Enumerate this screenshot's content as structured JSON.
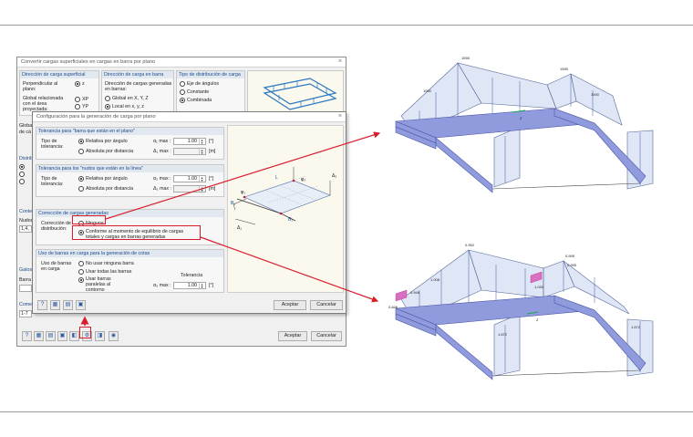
{
  "back_dialog": {
    "title": "Convertir cargas superficiales en cargas en barra por plano",
    "close_glyph": "×",
    "groups": {
      "load_direction_surface": {
        "header": "Dirección de carga superficial",
        "perpendicular_label": "Perpendicular al plano:",
        "perpendicular_option": "z",
        "global_label": "Global relacionada con el área proyectada:",
        "xp_option": "XP",
        "yp_option": "YP"
      },
      "load_direction_member": {
        "header": "Dirección de carga en barra",
        "description": "Dirección de cargas generadas en barras:",
        "global_option": "Global en X, Y, Z",
        "local_option": "Local en x, y, z"
      },
      "distribution_type": {
        "header": "Tipo de distribución de carga",
        "options": [
          "Eje de ángulos",
          "Constante",
          "Combinada"
        ]
      }
    },
    "side_labels": [
      "Global",
      "de cá",
      "Distrib",
      "Conte",
      "Nudos",
      "1,4,",
      "Gatos",
      "Barra",
      "Comer",
      "1-7"
    ],
    "accept_label": "Aceptar",
    "cancel_label": "Cancelar"
  },
  "front_dialog": {
    "title": "Configuración para la generación de carga por plano",
    "close_glyph": "×",
    "tolerance_plane": {
      "header": "Tolerancia para \"barra que están en el plano\"",
      "type_label": "Tipo de tolerancia:",
      "relative_option": "Relativa por ángulo",
      "absolute_option": "Absoluta por distancia",
      "angle_label": "α₁ max :",
      "angle_value": "1.00",
      "angle_unit": "[°]",
      "dist_label": "Δ₁ max :",
      "dist_value": "",
      "dist_unit": "[m]"
    },
    "tolerance_nodes": {
      "header": "Tolerancia para los \"nudos que están en la línea\"",
      "type_label": "Tipo de tolerancia:",
      "relative_option": "Relativa por ángulo",
      "absolute_option": "Absoluta por distancia",
      "angle_label": "α₂ max :",
      "angle_value": "1.00",
      "angle_unit": "[°]",
      "dist_label": "Δ₂ max :",
      "dist_value": "",
      "dist_unit": "[m]"
    },
    "load_correction": {
      "header": "Corrección de cargas generadas",
      "distribution_label": "Corrección de distribución:",
      "none_option": "Ninguna",
      "equilibrium_option": "Conforme al momento de equilibrio de cargas totales y cargas en barras generadas"
    },
    "member_use": {
      "header": "Uso de barras en carga para la generación de cotas",
      "use_label": "Uso de barras en carga",
      "none_option": "No usar ninguna barra",
      "all_option": "Usar todas las barras",
      "parallel_option": "Usar barras paralelas al contorno",
      "tolerance_title": "Tolerancia",
      "angle_label": "α₃ max :",
      "angle_value": "1.00",
      "angle_unit": "[°]"
    },
    "preview_labels": [
      "L",
      "φ₂",
      "Δ₂",
      "φ₁",
      "B₁",
      "B₂",
      "Δ₁"
    ],
    "accept_label": "Aceptar",
    "cancel_label": "Cancelar"
  },
  "model_top": {
    "values": [
      "1555",
      "1000",
      "1000",
      "1555"
    ],
    "axis_label": "Z"
  },
  "model_bottom": {
    "values": [
      "0.952",
      "0.595",
      "1.008",
      "0.995",
      "0.846",
      "1.030",
      "0.948",
      "1.672",
      "1.672"
    ],
    "axis_label": "Z"
  },
  "colors": {
    "accent_blue": "#1a4b8c",
    "highlight_red": "#d81e2c",
    "member_fill": "#8f9bdc",
    "load_fill": "#c5d1ec"
  }
}
